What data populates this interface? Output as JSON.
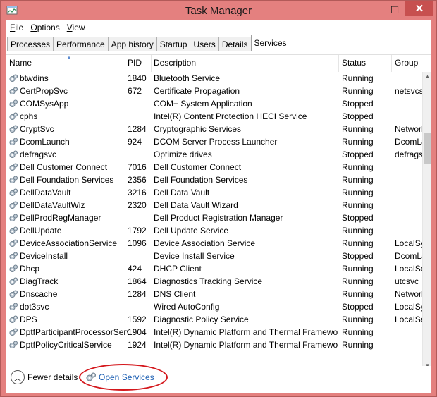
{
  "window": {
    "title": "Task Manager",
    "minimize_glyph": "—",
    "maximize_glyph": "☐",
    "close_glyph": "✕"
  },
  "menu": [
    "File",
    "Options",
    "View"
  ],
  "tabs": [
    "Processes",
    "Performance",
    "App history",
    "Startup",
    "Users",
    "Details",
    "Services"
  ],
  "active_tab": "Services",
  "columns": {
    "name": "Name",
    "pid": "PID",
    "description": "Description",
    "status": "Status",
    "group": "Group"
  },
  "rows": [
    {
      "name": "btwdins",
      "pid": "1840",
      "description": "Bluetooth Service",
      "status": "Running",
      "group": ""
    },
    {
      "name": "CertPropSvc",
      "pid": "672",
      "description": "Certificate Propagation",
      "status": "Running",
      "group": "netsvcs"
    },
    {
      "name": "COMSysApp",
      "pid": "",
      "description": "COM+ System Application",
      "status": "Stopped",
      "group": ""
    },
    {
      "name": "cphs",
      "pid": "",
      "description": "Intel(R) Content Protection HECI Service",
      "status": "Stopped",
      "group": ""
    },
    {
      "name": "CryptSvc",
      "pid": "1284",
      "description": "Cryptographic Services",
      "status": "Running",
      "group": "NetworkService"
    },
    {
      "name": "DcomLaunch",
      "pid": "924",
      "description": "DCOM Server Process Launcher",
      "status": "Running",
      "group": "DcomLaunch"
    },
    {
      "name": "defragsvc",
      "pid": "",
      "description": "Optimize drives",
      "status": "Stopped",
      "group": "defragsvc"
    },
    {
      "name": "Dell Customer Connect",
      "pid": "7016",
      "description": "Dell Customer Connect",
      "status": "Running",
      "group": ""
    },
    {
      "name": "Dell Foundation Services",
      "pid": "2356",
      "description": "Dell Foundation Services",
      "status": "Running",
      "group": ""
    },
    {
      "name": "DellDataVault",
      "pid": "3216",
      "description": "Dell Data Vault",
      "status": "Running",
      "group": ""
    },
    {
      "name": "DellDataVaultWiz",
      "pid": "2320",
      "description": "Dell Data Vault Wizard",
      "status": "Running",
      "group": ""
    },
    {
      "name": "DellProdRegManager",
      "pid": "",
      "description": "Dell Product Registration Manager",
      "status": "Stopped",
      "group": ""
    },
    {
      "name": "DellUpdate",
      "pid": "1792",
      "description": "Dell Update Service",
      "status": "Running",
      "group": ""
    },
    {
      "name": "DeviceAssociationService",
      "pid": "1096",
      "description": "Device Association Service",
      "status": "Running",
      "group": "LocalSystem"
    },
    {
      "name": "DeviceInstall",
      "pid": "",
      "description": "Device Install Service",
      "status": "Stopped",
      "group": "DcomLaunch"
    },
    {
      "name": "Dhcp",
      "pid": "424",
      "description": "DHCP Client",
      "status": "Running",
      "group": "LocalService"
    },
    {
      "name": "DiagTrack",
      "pid": "1864",
      "description": "Diagnostics Tracking Service",
      "status": "Running",
      "group": "utcsvc"
    },
    {
      "name": "Dnscache",
      "pid": "1284",
      "description": "DNS Client",
      "status": "Running",
      "group": "NetworkService"
    },
    {
      "name": "dot3svc",
      "pid": "",
      "description": "Wired AutoConfig",
      "status": "Stopped",
      "group": "LocalSystem"
    },
    {
      "name": "DPS",
      "pid": "1592",
      "description": "Diagnostic Policy Service",
      "status": "Running",
      "group": "LocalService"
    },
    {
      "name": "DptfParticipantProcessorService",
      "pid": "1904",
      "description": "Intel(R) Dynamic Platform and Thermal Framework Processor Participant",
      "status": "Running",
      "group": ""
    },
    {
      "name": "DptfPolicyCriticalService",
      "pid": "1924",
      "description": "Intel(R) Dynamic Platform and Thermal Framework Critical Policy",
      "status": "Running",
      "group": ""
    }
  ],
  "footer": {
    "fewer_details": "Fewer details",
    "open_services": "Open Services"
  },
  "colors": {
    "titlebar": "#e4807f",
    "close_button": "#c7504f",
    "link": "#1c5fb3",
    "highlight": "#d4171c"
  }
}
